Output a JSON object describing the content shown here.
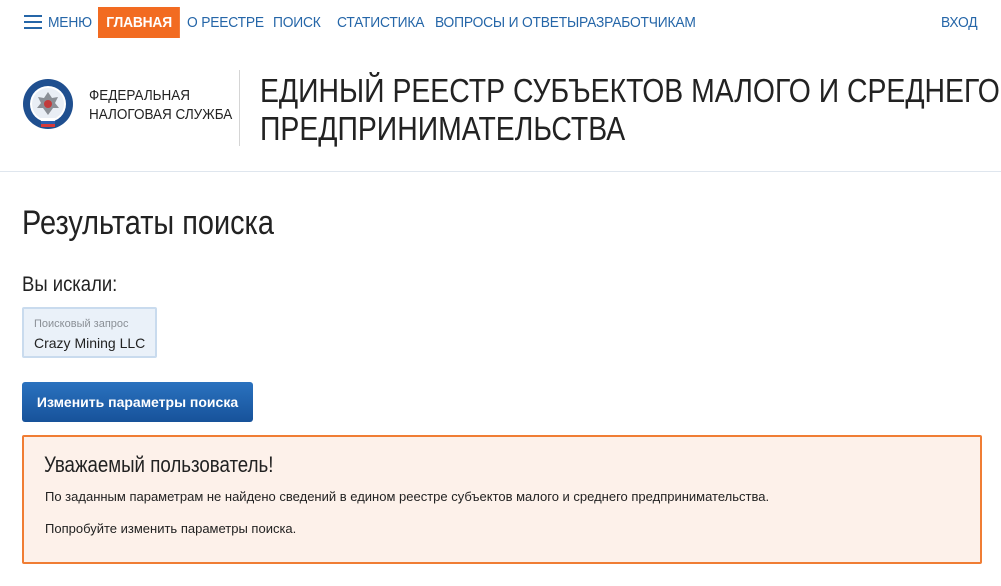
{
  "nav": {
    "menu_label": "МЕНЮ",
    "items": [
      "ГЛАВНАЯ",
      "О РЕЕСТРЕ",
      "ПОИСК",
      "СТАТИСТИКА",
      "ВОПРОСЫ И ОТВЕТЫ",
      "РАЗРАБОТЧИКАМ"
    ],
    "active_item": "ГЛАВНАЯ",
    "login_label": "ВХОД"
  },
  "header": {
    "org_line1": "ФЕДЕРАЛЬНАЯ",
    "org_line2": "НАЛОГОВАЯ СЛУЖБА",
    "title_line1": "ЕДИНЫЙ РЕЕСТР СУБЪЕКТОВ МАЛОГО И СРЕДНЕГО",
    "title_line2": "ПРЕДПРИНИМАТЕЛЬСТВА",
    "emblem_icon": "fns-emblem-icon"
  },
  "content": {
    "page_title": "Результаты поиска",
    "searched_label": "Вы искали:",
    "query_caption": "Поисковый запрос",
    "query_value": "Crazy Mining LLC",
    "change_button": "Изменить параметры поиска"
  },
  "notice": {
    "title": "Уважаемый пользователь!",
    "line1": "По заданным параметрам не найдено сведений в едином реестре субъектов малого и среднего предпринимательства.",
    "line2": "Попробуйте изменить параметры поиска."
  },
  "colors": {
    "nav_link": "#2566a8",
    "active_nav_bg": "#f26b21",
    "button_bg": "#1d5ea8",
    "notice_border": "#f07d34",
    "notice_bg": "#fdf1ea",
    "query_bg": "#eaf1f9"
  }
}
